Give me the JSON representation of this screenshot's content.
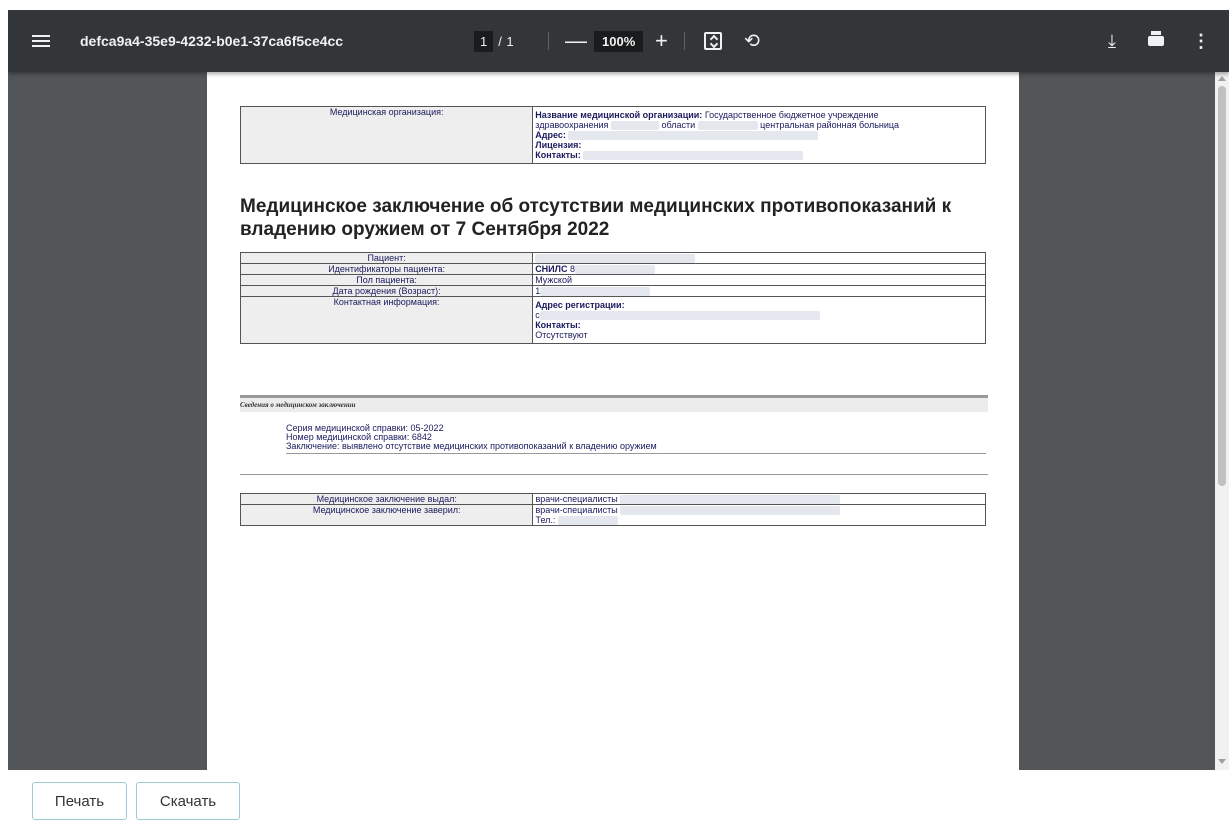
{
  "viewer": {
    "doc_title": "defca9a4-35e9-4232-b0e1-37ca6f5ce4cc",
    "page_current": "1",
    "page_sep": "/",
    "page_total": "1",
    "zoom_minus": "—",
    "zoom": "100%",
    "zoom_plus": "+",
    "icons": [
      "menu-icon",
      "fit-to-page-icon",
      "rotate-icon",
      "download-icon",
      "print-icon",
      "more-vert-icon"
    ]
  },
  "document": {
    "org_label": "Медицинская организация:",
    "org_name_label": "Название медицинской организации:",
    "org_name_value": "Государственное бюджетное учреждение",
    "org_line2_a": "здравоохранения",
    "org_line2_b": "области",
    "org_line2_c": "центральная районная больница",
    "address_label": "Адрес:",
    "license_label": "Лицензия:",
    "contacts_label": "Контакты:",
    "heading": "Медицинское заключение об отсутствии медицинских противопоказаний к владению оружием от 7 Сентября 2022",
    "patient": {
      "patient_label": "Пациент:",
      "ids_label": "Идентификаторы пациента:",
      "snils_label": "СНИЛС",
      "snils_value": "8",
      "sex_label": "Пол пациента:",
      "sex_value": "Мужской",
      "dob_label": "Дата рождения (Возраст):",
      "dob_value": "1",
      "contact_label": "Контактная информация:",
      "reg_address_label": "Адрес регистрации:",
      "reg_address_value": "с",
      "contacts_label": "Контакты:",
      "contacts_value": "Отсутствуют"
    },
    "section_title": "Сведения о медицинском заключении",
    "series_line": "Серия медицинской справки: 05-2022",
    "number_line": "Номер медицинской справки: 6842",
    "conclusion_line": "Заключение: выявлено отсутствие медицинских противопоказаний к владению оружием",
    "issued_label": "Медицинское заключение выдал:",
    "issued_value": "врачи-специалисты",
    "certified_label": "Медицинское заключение заверил:",
    "certified_value": "врачи-специалисты",
    "phone_label": "Тел.:"
  },
  "buttons": {
    "print": "Печать",
    "download": "Скачать"
  },
  "colors": {
    "toolbar": "#323639",
    "viewer_bg": "#525659",
    "button_border": "#9ccbd6",
    "doc_text": "#1a1a5e"
  }
}
